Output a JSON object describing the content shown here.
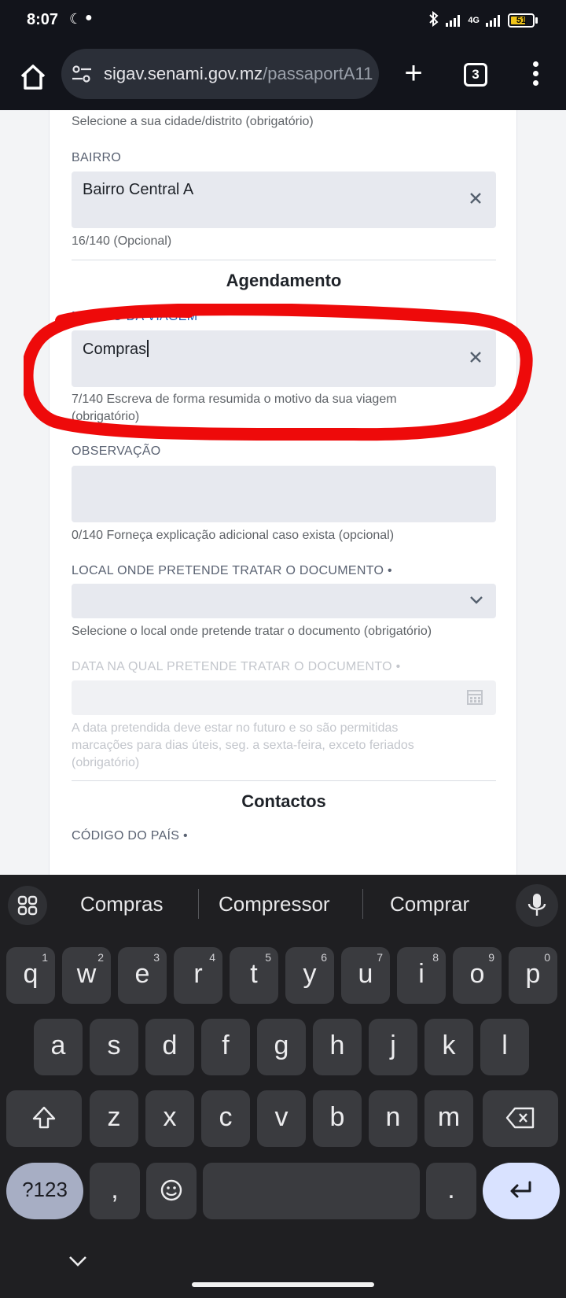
{
  "status": {
    "time": "8:07",
    "network": "4G",
    "battery": "51"
  },
  "browser": {
    "url_domain": "sigav.senami.gov.mz",
    "url_path": "/passaportA11",
    "tab_count": "3"
  },
  "form": {
    "city_helper": "Selecione a sua cidade/distrito (obrigatório)",
    "bairro_label": "BAIRRO",
    "bairro_value": "Bairro Central A",
    "bairro_helper": "16/140 (Opcional)",
    "section_agendamento": "Agendamento",
    "motivo_label": "MOTIVO DA VIAGEM",
    "motivo_value": "Compras",
    "motivo_helper_1": "7/140 Escreva de forma resumida o motivo da sua viagem",
    "motivo_helper_2": "(obrigatório)",
    "observacao_label": "OBSERVAÇÃO",
    "observacao_value": "",
    "observacao_helper": "0/140 Forneça explicação adicional caso exista (opcional)",
    "local_label": "LOCAL ONDE PRETENDE TRATAR O DOCUMENTO •",
    "local_helper": "Selecione o local onde pretende tratar o documento (obrigatório)",
    "data_label": "DATA NA QUAL PRETENDE TRATAR O DOCUMENTO •",
    "data_helper_1": "A data pretendida deve estar no futuro e so são permitidas",
    "data_helper_2": "marcações para dias úteis, seg. a sexta-feira, exceto feriados",
    "data_helper_3": "(obrigatório)",
    "section_contactos": "Contactos",
    "codigo_label": "CÓDIGO DO PAÍS •"
  },
  "keyboard": {
    "suggestions": [
      "Compras",
      "Compressor",
      "Comprar"
    ],
    "row1": [
      [
        "q",
        "1"
      ],
      [
        "w",
        "2"
      ],
      [
        "e",
        "3"
      ],
      [
        "r",
        "4"
      ],
      [
        "t",
        "5"
      ],
      [
        "y",
        "6"
      ],
      [
        "u",
        "7"
      ],
      [
        "i",
        "8"
      ],
      [
        "o",
        "9"
      ],
      [
        "p",
        "0"
      ]
    ],
    "row2": [
      "a",
      "s",
      "d",
      "f",
      "g",
      "h",
      "j",
      "k",
      "l"
    ],
    "row3": [
      "z",
      "x",
      "c",
      "v",
      "b",
      "n",
      "m"
    ],
    "symbols_key": "?123",
    "comma_key": ",",
    "period_key": "."
  }
}
